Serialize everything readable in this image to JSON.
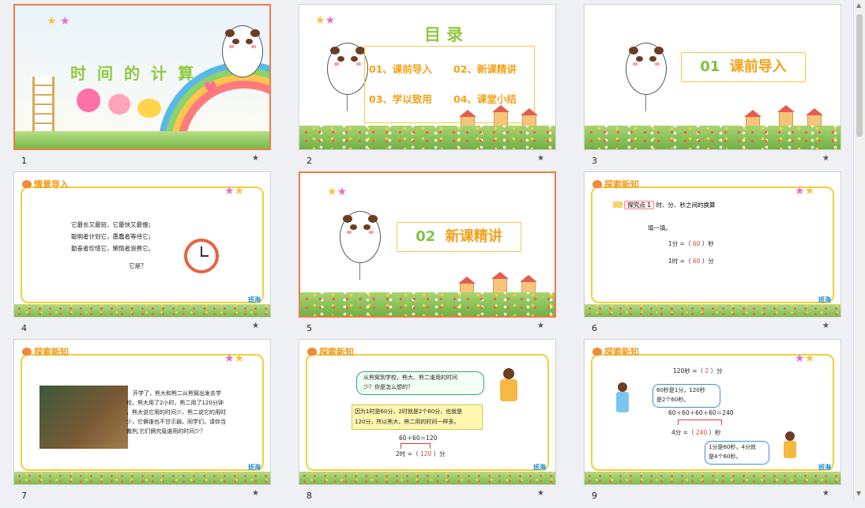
{
  "slides": [
    {
      "number": "1",
      "title": "时间的计算"
    },
    {
      "number": "2",
      "title": "目 录",
      "items": [
        "01、课前导入",
        "02、新课精讲",
        "03、学以致用",
        "04、课堂小结"
      ]
    },
    {
      "number": "3",
      "section_num": "01",
      "section_title": "课前导入"
    },
    {
      "number": "4",
      "header": "情景导入",
      "lines": [
        "它最长又最短，它最快又最慢；",
        "聪明者计划它，愚蠢者等待它；",
        "勤奋者珍惜它，懒惰者浪费它。"
      ],
      "question": "它是？",
      "brand": "班海"
    },
    {
      "number": "5",
      "section_num": "02",
      "section_title": "新课精讲"
    },
    {
      "number": "6",
      "header": "探索新知",
      "tag": "探究点 1",
      "tag_text": "时、分、秒之间的换算",
      "prompt": "填一填。",
      "eq1_prefix": "1分 =（",
      "eq1_value": "60",
      "eq1_suffix": "）秒",
      "eq2_prefix": "1时 =（",
      "eq2_value": "60",
      "eq2_suffix": "）分",
      "brand": "班海"
    },
    {
      "number": "7",
      "header": "探索新知",
      "lines": [
        "开学了，熊大和熊二从熊窝出发去学",
        "校，熊大用了2小时，熊二用了120分钟",
        "，熊大说它用的时间少，熊二说它的用时",
        "少，它俩谁也不甘示弱。同学们，请你当",
        "裁判,它们俩究竟谁用的时间少？"
      ],
      "brand": "班海"
    },
    {
      "number": "8",
      "header": "探索新知",
      "bubble": [
        "从熊窝到学校，熊大、熊二谁用的时间",
        "少？你是怎么想的？"
      ],
      "note": [
        "因为1时是60分，2时就是2个60分，也就是",
        "120分，所以熊大、熊二用的时间一样多。"
      ],
      "calc": "60＋60＝120",
      "result_prefix": "2时 =（",
      "result_value": "120",
      "result_suffix": "）分",
      "brand": "班海"
    },
    {
      "number": "9",
      "header": "探索新知",
      "top_prefix": "120秒 =（",
      "top_value": "2",
      "top_suffix": "）分",
      "bubble1": [
        "60秒是1分，120秒",
        "是2个60秒。"
      ],
      "calc": "60＋60＋60＋60＝240",
      "res_prefix": "4分 =（",
      "res_value": "240",
      "res_suffix": "）秒",
      "bubble2": [
        "1分是60秒，4分就",
        "是4个60秒。"
      ],
      "brand": "班海"
    }
  ],
  "star_glyph": "★",
  "scroll": {
    "up": "▲",
    "down": "▼"
  }
}
